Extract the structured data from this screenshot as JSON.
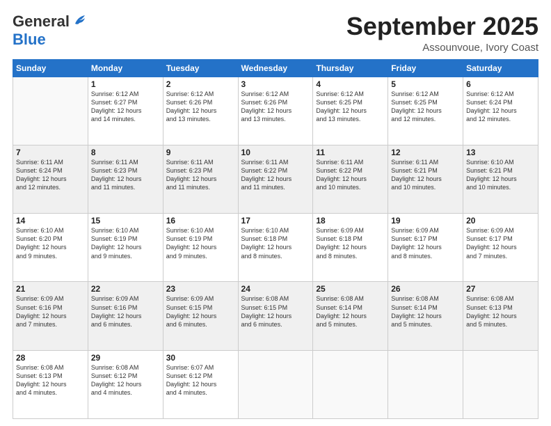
{
  "logo": {
    "general": "General",
    "blue": "Blue"
  },
  "title": "September 2025",
  "location": "Assounvoue, Ivory Coast",
  "weekdays": [
    "Sunday",
    "Monday",
    "Tuesday",
    "Wednesday",
    "Thursday",
    "Friday",
    "Saturday"
  ],
  "weeks": [
    [
      {
        "day": null,
        "info": null
      },
      {
        "day": "1",
        "info": "Sunrise: 6:12 AM\nSunset: 6:27 PM\nDaylight: 12 hours\nand 14 minutes."
      },
      {
        "day": "2",
        "info": "Sunrise: 6:12 AM\nSunset: 6:26 PM\nDaylight: 12 hours\nand 13 minutes."
      },
      {
        "day": "3",
        "info": "Sunrise: 6:12 AM\nSunset: 6:26 PM\nDaylight: 12 hours\nand 13 minutes."
      },
      {
        "day": "4",
        "info": "Sunrise: 6:12 AM\nSunset: 6:25 PM\nDaylight: 12 hours\nand 13 minutes."
      },
      {
        "day": "5",
        "info": "Sunrise: 6:12 AM\nSunset: 6:25 PM\nDaylight: 12 hours\nand 12 minutes."
      },
      {
        "day": "6",
        "info": "Sunrise: 6:12 AM\nSunset: 6:24 PM\nDaylight: 12 hours\nand 12 minutes."
      }
    ],
    [
      {
        "day": "7",
        "info": "Sunrise: 6:11 AM\nSunset: 6:24 PM\nDaylight: 12 hours\nand 12 minutes."
      },
      {
        "day": "8",
        "info": "Sunrise: 6:11 AM\nSunset: 6:23 PM\nDaylight: 12 hours\nand 11 minutes."
      },
      {
        "day": "9",
        "info": "Sunrise: 6:11 AM\nSunset: 6:23 PM\nDaylight: 12 hours\nand 11 minutes."
      },
      {
        "day": "10",
        "info": "Sunrise: 6:11 AM\nSunset: 6:22 PM\nDaylight: 12 hours\nand 11 minutes."
      },
      {
        "day": "11",
        "info": "Sunrise: 6:11 AM\nSunset: 6:22 PM\nDaylight: 12 hours\nand 10 minutes."
      },
      {
        "day": "12",
        "info": "Sunrise: 6:11 AM\nSunset: 6:21 PM\nDaylight: 12 hours\nand 10 minutes."
      },
      {
        "day": "13",
        "info": "Sunrise: 6:10 AM\nSunset: 6:21 PM\nDaylight: 12 hours\nand 10 minutes."
      }
    ],
    [
      {
        "day": "14",
        "info": "Sunrise: 6:10 AM\nSunset: 6:20 PM\nDaylight: 12 hours\nand 9 minutes."
      },
      {
        "day": "15",
        "info": "Sunrise: 6:10 AM\nSunset: 6:19 PM\nDaylight: 12 hours\nand 9 minutes."
      },
      {
        "day": "16",
        "info": "Sunrise: 6:10 AM\nSunset: 6:19 PM\nDaylight: 12 hours\nand 9 minutes."
      },
      {
        "day": "17",
        "info": "Sunrise: 6:10 AM\nSunset: 6:18 PM\nDaylight: 12 hours\nand 8 minutes."
      },
      {
        "day": "18",
        "info": "Sunrise: 6:09 AM\nSunset: 6:18 PM\nDaylight: 12 hours\nand 8 minutes."
      },
      {
        "day": "19",
        "info": "Sunrise: 6:09 AM\nSunset: 6:17 PM\nDaylight: 12 hours\nand 8 minutes."
      },
      {
        "day": "20",
        "info": "Sunrise: 6:09 AM\nSunset: 6:17 PM\nDaylight: 12 hours\nand 7 minutes."
      }
    ],
    [
      {
        "day": "21",
        "info": "Sunrise: 6:09 AM\nSunset: 6:16 PM\nDaylight: 12 hours\nand 7 minutes."
      },
      {
        "day": "22",
        "info": "Sunrise: 6:09 AM\nSunset: 6:16 PM\nDaylight: 12 hours\nand 6 minutes."
      },
      {
        "day": "23",
        "info": "Sunrise: 6:09 AM\nSunset: 6:15 PM\nDaylight: 12 hours\nand 6 minutes."
      },
      {
        "day": "24",
        "info": "Sunrise: 6:08 AM\nSunset: 6:15 PM\nDaylight: 12 hours\nand 6 minutes."
      },
      {
        "day": "25",
        "info": "Sunrise: 6:08 AM\nSunset: 6:14 PM\nDaylight: 12 hours\nand 5 minutes."
      },
      {
        "day": "26",
        "info": "Sunrise: 6:08 AM\nSunset: 6:14 PM\nDaylight: 12 hours\nand 5 minutes."
      },
      {
        "day": "27",
        "info": "Sunrise: 6:08 AM\nSunset: 6:13 PM\nDaylight: 12 hours\nand 5 minutes."
      }
    ],
    [
      {
        "day": "28",
        "info": "Sunrise: 6:08 AM\nSunset: 6:13 PM\nDaylight: 12 hours\nand 4 minutes."
      },
      {
        "day": "29",
        "info": "Sunrise: 6:08 AM\nSunset: 6:12 PM\nDaylight: 12 hours\nand 4 minutes."
      },
      {
        "day": "30",
        "info": "Sunrise: 6:07 AM\nSunset: 6:12 PM\nDaylight: 12 hours\nand 4 minutes."
      },
      {
        "day": null,
        "info": null
      },
      {
        "day": null,
        "info": null
      },
      {
        "day": null,
        "info": null
      },
      {
        "day": null,
        "info": null
      }
    ]
  ]
}
